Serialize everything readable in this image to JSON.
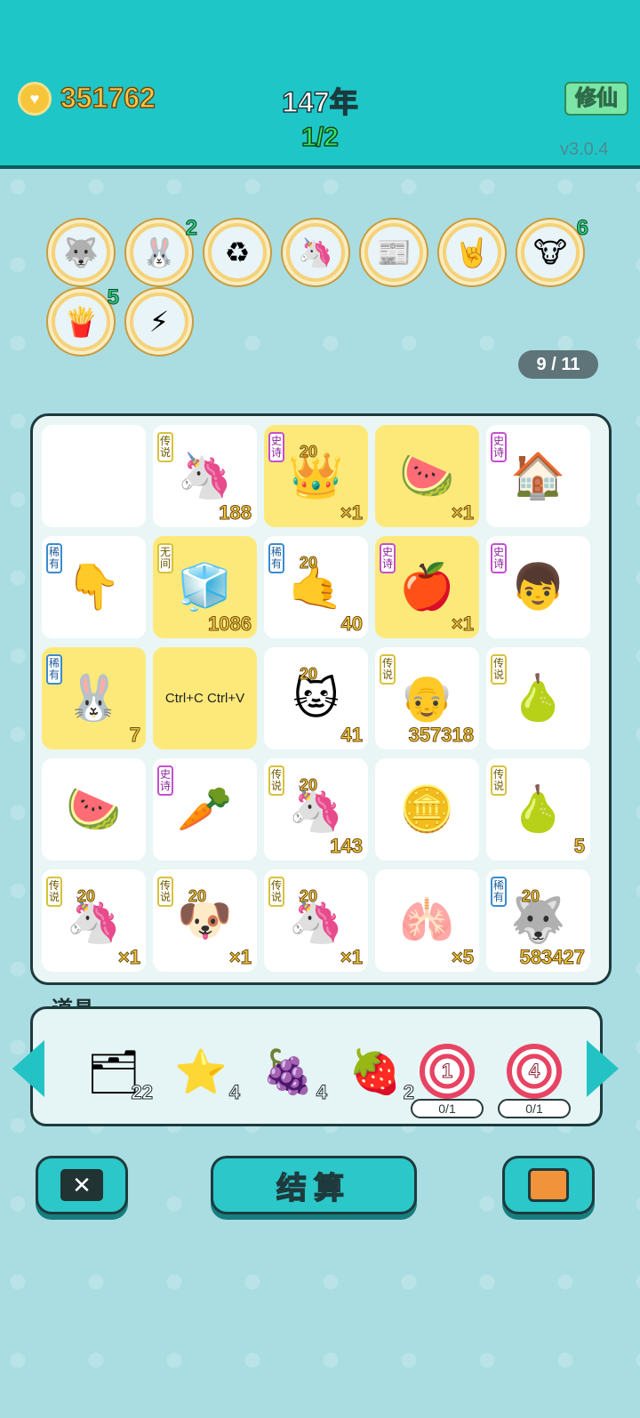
{
  "header": {
    "coins": "351762",
    "year": "147年",
    "round": "1/2",
    "mode_button": "修仙",
    "version": "v3.0.4"
  },
  "relics": [
    {
      "icon": "husky-icon",
      "glyph": "🐺",
      "count": ""
    },
    {
      "icon": "rabbit-icon",
      "glyph": "🐰",
      "count": "2"
    },
    {
      "icon": "recycle-icon",
      "glyph": "♻",
      "count": ""
    },
    {
      "icon": "unicorn-icon",
      "glyph": "🦄",
      "count": ""
    },
    {
      "icon": "time-magazine-icon",
      "glyph": "📰",
      "count": ""
    },
    {
      "icon": "rock-hand-icon",
      "glyph": "🤘",
      "count": ""
    },
    {
      "icon": "cows-icon",
      "glyph": "🐮",
      "count": "6"
    },
    {
      "icon": "fries-icon",
      "glyph": "🍟",
      "count": "5"
    },
    {
      "icon": "lightning-icon",
      "glyph": "⚡",
      "count": ""
    }
  ],
  "page_indicator": "9 / 11",
  "board": [
    {
      "glyph": "",
      "tag": "",
      "value": ""
    },
    {
      "glyph": "🦄",
      "tag": "传说",
      "value": "188"
    },
    {
      "glyph": "👑",
      "tag": "史诗",
      "value": "×1",
      "gold": true,
      "badge": "20"
    },
    {
      "glyph": "🍉",
      "tag": "",
      "value": "×1",
      "gold": true
    },
    {
      "glyph": "🏠",
      "tag": "史诗",
      "value": ""
    },
    {
      "glyph": "👇",
      "tag": "稀有",
      "value": ""
    },
    {
      "glyph": "🧊",
      "tag": "无间",
      "value": "1086",
      "gold": true
    },
    {
      "glyph": "🤙",
      "tag": "稀有",
      "value": "40",
      "badge": "20"
    },
    {
      "glyph": "🍎",
      "tag": "史诗",
      "value": "×1",
      "gold": true
    },
    {
      "glyph": "👦",
      "tag": "史诗",
      "value": ""
    },
    {
      "glyph": "🐰",
      "tag": "稀有",
      "value": "7",
      "gold": true
    },
    {
      "glyph": "📋",
      "tag": "",
      "value": "",
      "gold": true,
      "text": "Ctrl+C Ctrl+V"
    },
    {
      "glyph": "🐱",
      "tag": "",
      "value": "41",
      "badge": "20"
    },
    {
      "glyph": "👴",
      "tag": "传说",
      "value": "357318"
    },
    {
      "glyph": "🍐",
      "tag": "传说",
      "value": ""
    },
    {
      "glyph": "🍉",
      "tag": "",
      "value": ""
    },
    {
      "glyph": "🥕",
      "tag": "史诗",
      "value": ""
    },
    {
      "glyph": "🦄",
      "tag": "传说",
      "value": "143",
      "badge": "20"
    },
    {
      "glyph": "🪙",
      "tag": "",
      "value": ""
    },
    {
      "glyph": "🍐",
      "tag": "传说",
      "value": "5"
    },
    {
      "glyph": "🦄",
      "tag": "传说",
      "value": "×1",
      "badge": "20"
    },
    {
      "glyph": "🐶",
      "tag": "传说",
      "value": "×1",
      "badge": "20"
    },
    {
      "glyph": "🦄",
      "tag": "传说",
      "value": "×1",
      "badge": "20"
    },
    {
      "glyph": "🫁",
      "tag": "",
      "value": "×5"
    },
    {
      "glyph": "🐺",
      "tag": "稀有",
      "value": "583427",
      "badge": "20"
    }
  ],
  "props_title": "道具",
  "props": [
    {
      "icon": "cards-icon",
      "glyph": "🗂",
      "count": "22"
    },
    {
      "icon": "star-icon",
      "glyph": "⭐",
      "count": "4"
    },
    {
      "icon": "lychee-icon",
      "glyph": "🍇",
      "count": "4"
    },
    {
      "icon": "strawberry-icon",
      "glyph": "🍓",
      "count": "2"
    }
  ],
  "targets": [
    {
      "num": "1",
      "limit": "0/1"
    },
    {
      "num": "4",
      "limit": "0/1"
    }
  ],
  "settle_button": "结算",
  "colors": {
    "accent": "#1fc6c8",
    "gold": "#f3c93d",
    "background": "#a9dde2"
  }
}
